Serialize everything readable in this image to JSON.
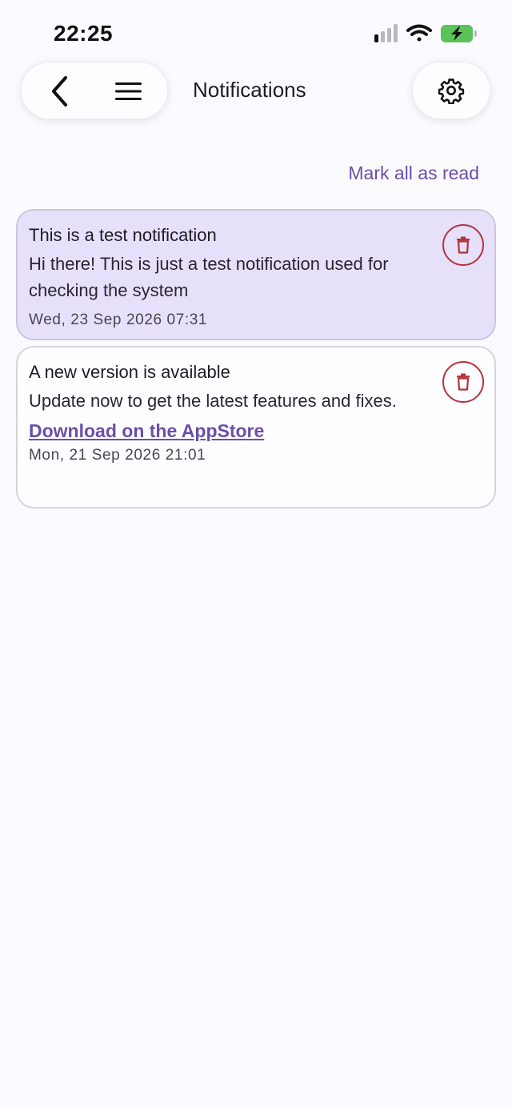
{
  "status_bar": {
    "time": "22:25"
  },
  "header": {
    "title": "Notifications",
    "icons": {
      "back": "chevron-left-icon",
      "menu": "hamburger-menu-icon",
      "settings": "gear-icon"
    }
  },
  "actions": {
    "mark_all_read": "Mark all as read"
  },
  "notifications": [
    {
      "title": "This is a test notification",
      "body": "Hi there! This is just a test notification used for checking the system",
      "time": "Wed, 23 Sep 2026 07:31",
      "unread": true
    },
    {
      "title": "A new version is available",
      "body": "Update now to get the latest features and fixes.",
      "link": "Download on the AppStore",
      "time": "Mon, 21 Sep 2026 21:01",
      "unread": false
    }
  ],
  "colors": {
    "accent": "#6a4fa8",
    "unread_background": "#e7e0fb",
    "delete": "#b3343a",
    "battery": "#5ac35a"
  }
}
